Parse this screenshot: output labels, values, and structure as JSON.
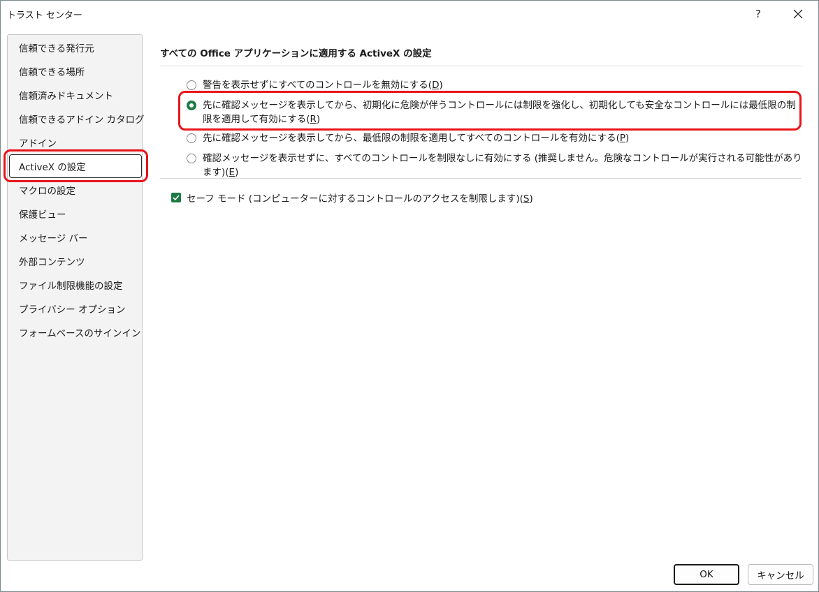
{
  "window": {
    "title": "トラスト センター",
    "help_label": "?"
  },
  "sidebar": {
    "items": [
      {
        "label": "信頼できる発行元"
      },
      {
        "label": "信頼できる場所"
      },
      {
        "label": "信頼済みドキュメント"
      },
      {
        "label": "信頼できるアドイン カタログ"
      },
      {
        "label": "アドイン"
      },
      {
        "label": "ActiveX の設定",
        "selected": true
      },
      {
        "label": "マクロの設定"
      },
      {
        "label": "保護ビュー"
      },
      {
        "label": "メッセージ バー"
      },
      {
        "label": "外部コンテンツ"
      },
      {
        "label": "ファイル制限機能の設定"
      },
      {
        "label": "プライバシー オプション"
      },
      {
        "label": "フォームベースのサインイン"
      }
    ]
  },
  "main": {
    "section_title": "すべての Office アプリケーションに適用する ActiveX の設定",
    "options": [
      {
        "text": "警告を表示せずにすべてのコントロールを無効にする(",
        "key": "D",
        "suffix": ")",
        "checked": false
      },
      {
        "text": "先に確認メッセージを表示してから、初期化に危険が伴うコントロールには制限を強化し、初期化しても安全なコントロールには最低限の制限を適用して有効にする(",
        "key": "R",
        "suffix": ")",
        "checked": true
      },
      {
        "text": "先に確認メッセージを表示してから、最低限の制限を適用してすべてのコントロールを有効にする(",
        "key": "P",
        "suffix": ")",
        "checked": false
      },
      {
        "text": "確認メッセージを表示せずに、すべてのコントロールを制限なしに有効にする (推奨しません。危険なコントロールが実行される可能性があります)(",
        "key": "E",
        "suffix": ")",
        "checked": false
      }
    ],
    "safe_mode": {
      "text": "セーフ モード (コンピューターに対するコントロールのアクセスを制限します)(",
      "key": "S",
      "suffix": ")",
      "checked": true
    }
  },
  "footer": {
    "ok_label": "OK",
    "cancel_label": "キャンセル"
  },
  "colors": {
    "accent": "#1e7a45",
    "highlight": "#e8141a"
  }
}
